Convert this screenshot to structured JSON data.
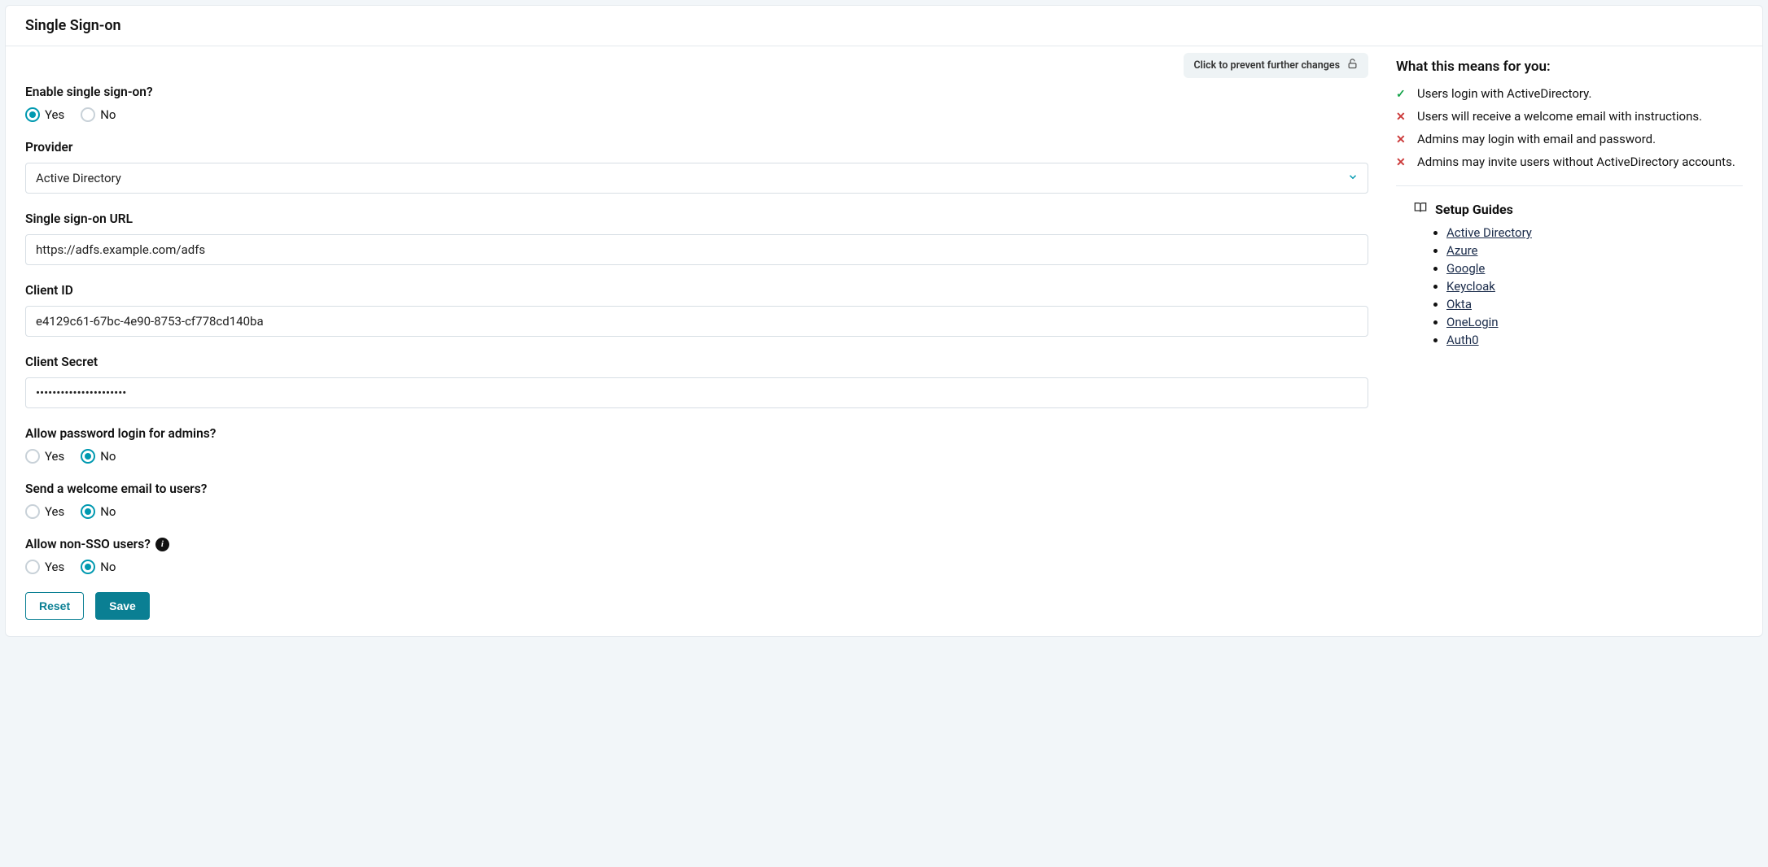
{
  "header": {
    "title": "Single Sign-on"
  },
  "lock": {
    "label": "Click to prevent further changes"
  },
  "form": {
    "enable": {
      "label": "Enable single sign-on?",
      "yes": "Yes",
      "no": "No",
      "value": "yes"
    },
    "provider": {
      "label": "Provider",
      "selected": "Active Directory"
    },
    "sso_url": {
      "label": "Single sign-on URL",
      "value": "https://adfs.example.com/adfs"
    },
    "client_id": {
      "label": "Client ID",
      "value": "e4129c61-67bc-4e90-8753-cf778cd140ba"
    },
    "client_secret": {
      "label": "Client Secret",
      "value": "••••••••••••••••••••••"
    },
    "admin_pw": {
      "label": "Allow password login for admins?",
      "yes": "Yes",
      "no": "No",
      "value": "no"
    },
    "welcome": {
      "label": "Send a welcome email to users?",
      "yes": "Yes",
      "no": "No",
      "value": "no"
    },
    "nonsso": {
      "label": "Allow non-SSO users?",
      "yes": "Yes",
      "no": "No",
      "value": "no"
    },
    "reset_btn": "Reset",
    "save_btn": "Save"
  },
  "means": {
    "heading": "What this means for you:",
    "items": [
      {
        "ok": true,
        "text": "Users login with ActiveDirectory."
      },
      {
        "ok": false,
        "text": "Users will receive a welcome email with instructions."
      },
      {
        "ok": false,
        "text": "Admins may login with email and password."
      },
      {
        "ok": false,
        "text": "Admins may invite users without ActiveDirectory accounts."
      }
    ]
  },
  "guides": {
    "heading": "Setup Guides",
    "links": [
      "Active Directory",
      "Azure",
      "Google",
      "Keycloak",
      "Okta",
      "OneLogin",
      "Auth0"
    ]
  }
}
